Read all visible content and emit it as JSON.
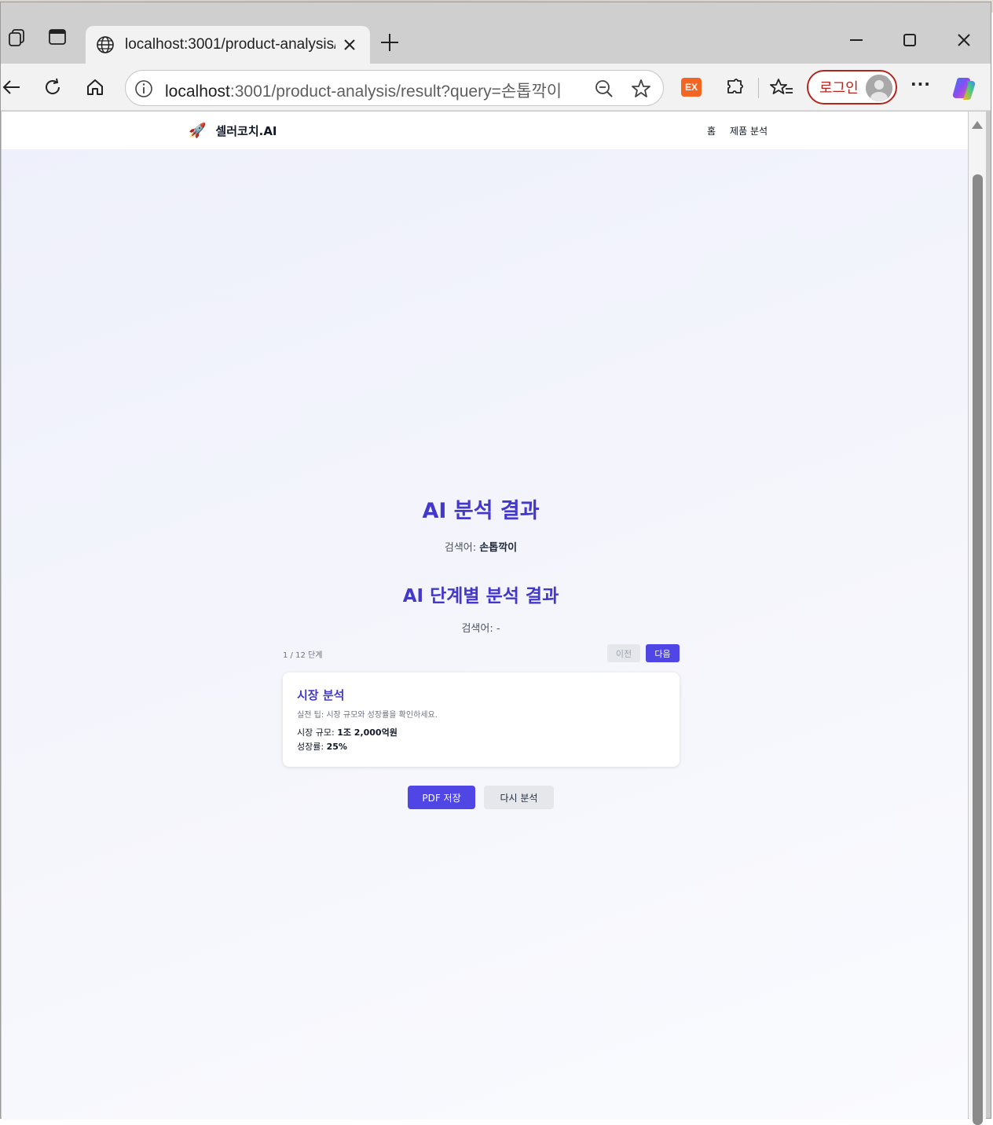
{
  "browser": {
    "tab_title": "localhost:3001/product-analysis/r",
    "url_host": "localhost",
    "url_rest": ":3001/product-analysis/result?query=손톱깍이",
    "extension_badge": "EX",
    "login_label": "로그인",
    "more_label": "···"
  },
  "site": {
    "brand_icon": "🚀",
    "brand_name": "셀러코치.AI",
    "nav": {
      "home": "홈",
      "product_analysis": "제품 분석"
    }
  },
  "result": {
    "title": "AI 분석 결과",
    "query_label": "검색어: ",
    "query_value": "손톱깍이",
    "step_title": "AI 단계별 분석 결과",
    "step_query": "검색어: -",
    "step_count": "1 / 12 단계",
    "prev_label": "이전",
    "next_label": "다음",
    "card": {
      "title": "시장 분석",
      "tip": "실전 팁: 시장 규모와 성장률을 확인하세요.",
      "market_size_label": "시장 규모: ",
      "market_size_value": "1조 2,000억원",
      "growth_label": "성장률: ",
      "growth_value": "25%"
    },
    "pdf_label": "PDF 저장",
    "retry_label": "다시 분석"
  },
  "colors": {
    "accent": "#4f46e5",
    "heading": "#4338ca",
    "login_border": "#b3261e"
  }
}
